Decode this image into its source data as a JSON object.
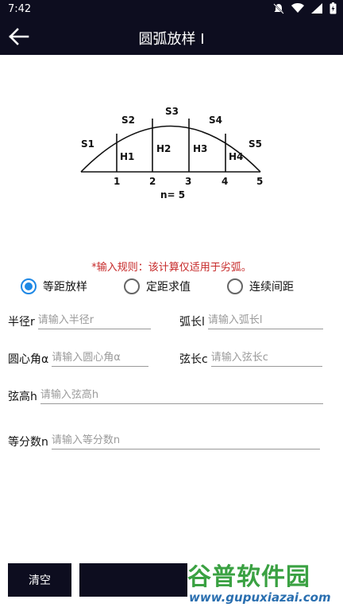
{
  "status": {
    "time": "7:42"
  },
  "header": {
    "title": "圆弧放样 I"
  },
  "diagram": {
    "segments": [
      "S1",
      "S2",
      "S3",
      "S4",
      "S5"
    ],
    "heights": [
      "H1",
      "H2",
      "H3",
      "H4"
    ],
    "points": [
      "1",
      "2",
      "3",
      "4",
      "5"
    ],
    "n_label": "n= 5"
  },
  "rule_text": "*输入规则：该计算仅适用于劣弧。",
  "modes": [
    {
      "label": "等距放样",
      "selected": true
    },
    {
      "label": "定距求值",
      "selected": false
    },
    {
      "label": "连续间距",
      "selected": false
    }
  ],
  "fields": {
    "radius": {
      "label": "半径r",
      "placeholder": "请输入半径r"
    },
    "arc_length": {
      "label": "弧长l",
      "placeholder": "请输入弧长l"
    },
    "central_angle": {
      "label": "圆心角α",
      "placeholder": "请输入圆心角α"
    },
    "chord_length": {
      "label": "弦长c",
      "placeholder": "请输入弦长c"
    },
    "chord_height": {
      "label": "弦高h",
      "placeholder": "请输入弦高h"
    },
    "divisions": {
      "label": "等分数n",
      "placeholder": "请输入等分数n"
    }
  },
  "buttons": {
    "clear": "清空"
  },
  "watermark": {
    "name": "谷普软件园",
    "url": "www.gupuxiazai.com"
  }
}
